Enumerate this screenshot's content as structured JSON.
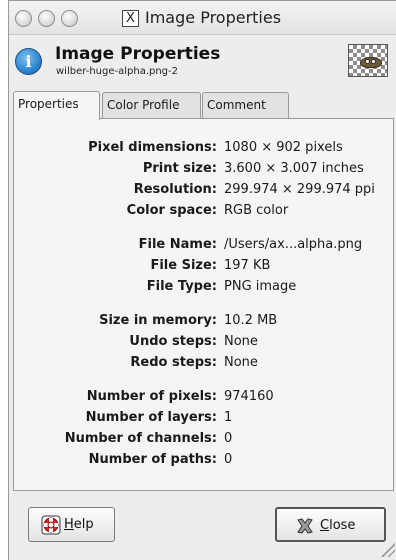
{
  "window": {
    "title": "Image Properties",
    "titlebar_icon": "x-window-icon"
  },
  "header": {
    "title": "Image Properties",
    "subtitle": "wilber-huge-alpha.png-2",
    "icon": "info-icon",
    "thumbnail": "image-thumbnail"
  },
  "tabs": [
    {
      "label": "Properties",
      "active": true
    },
    {
      "label": "Color Profile",
      "active": false
    },
    {
      "label": "Comment",
      "active": false
    }
  ],
  "properties": {
    "pixel_dimensions": {
      "label": "Pixel dimensions:",
      "value": "1080 × 902 pixels"
    },
    "print_size": {
      "label": "Print size:",
      "value": "3.600 × 3.007 inches"
    },
    "resolution": {
      "label": "Resolution:",
      "value": "299.974 × 299.974 ppi"
    },
    "color_space": {
      "label": "Color space:",
      "value": "RGB color"
    },
    "file_name": {
      "label": "File Name:",
      "value": "/Users/ax...alpha.png"
    },
    "file_size": {
      "label": "File Size:",
      "value": "197 KB"
    },
    "file_type": {
      "label": "File Type:",
      "value": "PNG image"
    },
    "size_in_memory": {
      "label": "Size in memory:",
      "value": "10.2 MB"
    },
    "undo_steps": {
      "label": "Undo steps:",
      "value": "None"
    },
    "redo_steps": {
      "label": "Redo steps:",
      "value": "None"
    },
    "number_of_pixels": {
      "label": "Number of pixels:",
      "value": "974160"
    },
    "number_of_layers": {
      "label": "Number of layers:",
      "value": "1"
    },
    "number_of_channels": {
      "label": "Number of channels:",
      "value": "0"
    },
    "number_of_paths": {
      "label": "Number of paths:",
      "value": "0"
    }
  },
  "buttons": {
    "help": {
      "mnemonic": "H",
      "rest": "elp",
      "icon": "lifebuoy-icon"
    },
    "close": {
      "mnemonic": "C",
      "rest": "lose",
      "icon": "close-x-icon"
    }
  }
}
